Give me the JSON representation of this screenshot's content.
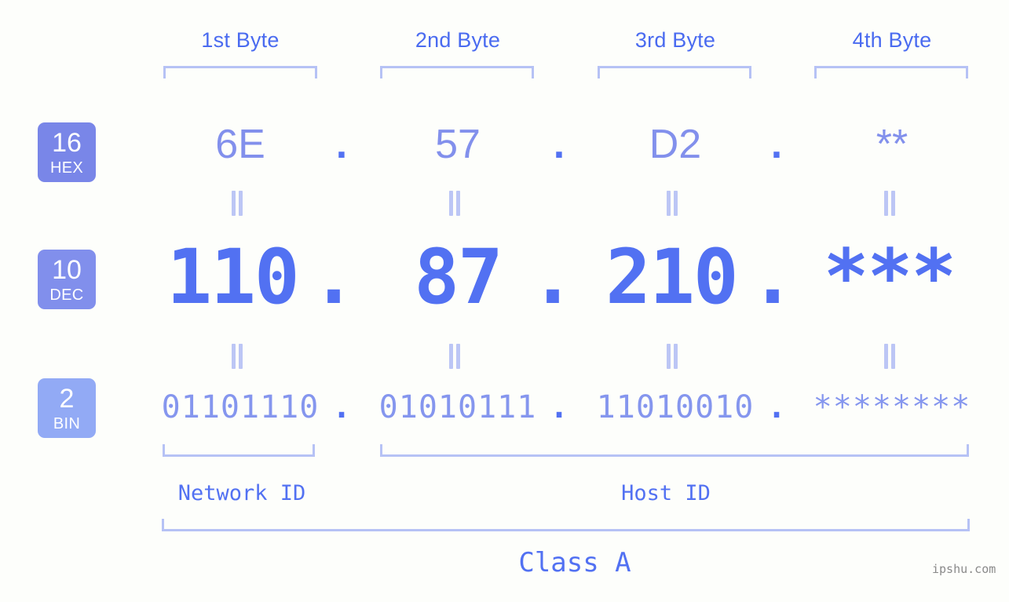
{
  "background_color": "#FDFEFB",
  "accent_colors": {
    "header_label": "#4A6BF0",
    "bracket": "#B6C2F5",
    "hex_text": "#8290EC",
    "dec_text": "#5271F2",
    "bin_text": "#8596EE",
    "equals_mark": "#BCC6F5",
    "badge_hex": "#7986E8",
    "badge_dec": "#818FEC",
    "badge_bin": "#92AAF5",
    "watermark": "#8A8A8A"
  },
  "headers": {
    "byte1": "1st Byte",
    "byte2": "2nd Byte",
    "byte3": "3rd Byte",
    "byte4": "4th Byte"
  },
  "badges": [
    {
      "number": "16",
      "abbr": "HEX"
    },
    {
      "number": "10",
      "abbr": "DEC"
    },
    {
      "number": "2",
      "abbr": "BIN"
    }
  ],
  "rows": {
    "hex": {
      "base": "16",
      "label": "HEX",
      "values": [
        "6E",
        "57",
        "D2",
        "**"
      ],
      "separator": "."
    },
    "dec": {
      "base": "10",
      "label": "DEC",
      "values": [
        "110",
        "87",
        "210",
        "***"
      ],
      "separator": "."
    },
    "bin": {
      "base": "2",
      "label": "BIN",
      "values": [
        "01101110",
        "01010111",
        "11010010",
        "********"
      ],
      "separator": "."
    }
  },
  "equals_symbol": "=",
  "sections": {
    "network_id": "Network ID",
    "host_id": "Host ID",
    "class": "Class A"
  },
  "watermark": "ipshu.com"
}
